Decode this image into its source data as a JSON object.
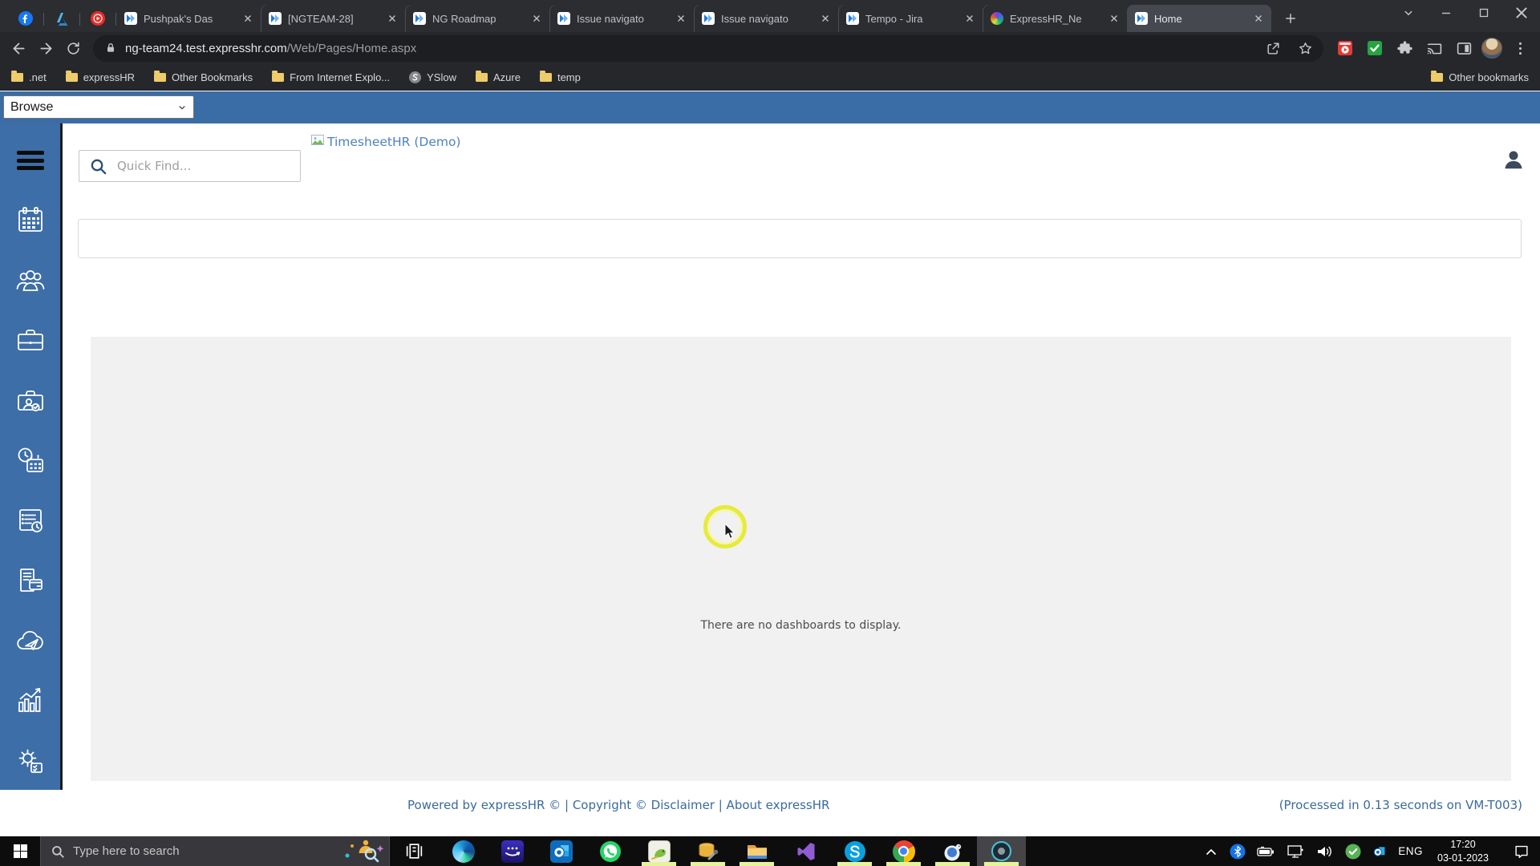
{
  "browser": {
    "pinned_tabs": [
      "facebook",
      "azure-devops",
      "youtube-music"
    ],
    "tabs": [
      {
        "label": "Pushpak's Das",
        "favicon": "jira"
      },
      {
        "label": "[NGTEAM-28]",
        "favicon": "jira"
      },
      {
        "label": "NG Roadmap",
        "favicon": "jira"
      },
      {
        "label": "Issue navigato",
        "favicon": "jira"
      },
      {
        "label": "Issue navigato",
        "favicon": "jira"
      },
      {
        "label": "Tempo - Jira",
        "favicon": "jira"
      },
      {
        "label": "ExpressHR_Ne",
        "favicon": "expresshr"
      },
      {
        "label": "Home",
        "favicon": "jira",
        "active": true
      }
    ],
    "address": {
      "domain": "ng-team24.test.expresshr.com",
      "path": "/Web/Pages/Home.aspx"
    },
    "bookmarks": [
      ".net",
      "expressHR",
      "Other Bookmarks",
      "From Internet Explo...",
      "YSlow",
      "Azure",
      "temp"
    ],
    "other_bookmarks_label": "Other bookmarks"
  },
  "page": {
    "browse_label": "Browse",
    "quick_find": {
      "placeholder": "Quick Find..."
    },
    "logo_alt_text": "TimesheetHR (Demo)",
    "empty_message": "There are no dashboards to display.",
    "footer": {
      "left": "Powered by expressHR © | Copyright © Disclaimer | About expressHR",
      "right": "(Processed in 0.13 seconds on VM-T003)"
    },
    "colors": {
      "accent_blue": "#3a6ca6",
      "link_blue": "#4e82bd",
      "spinner_yellow": "#e7ea3b"
    }
  },
  "sidebar": {
    "items": [
      "menu",
      "calendar",
      "team",
      "organization",
      "recruitment",
      "time-attendance",
      "timesheet",
      "payroll",
      "leave-requests",
      "reports",
      "settings"
    ]
  },
  "taskbar": {
    "search_placeholder": "Type here to search",
    "apps": [
      "task-view",
      "edge",
      "amazon-music",
      "outlook",
      "whatsapp",
      "notepad-plus-plus",
      "sql-server-management-studio",
      "file-explorer",
      "visual-studio",
      "skype",
      "chrome",
      "tortoise-svn",
      "screen-recorder"
    ],
    "language": "ENG",
    "time": "17:20",
    "date": "03-01-2023"
  }
}
